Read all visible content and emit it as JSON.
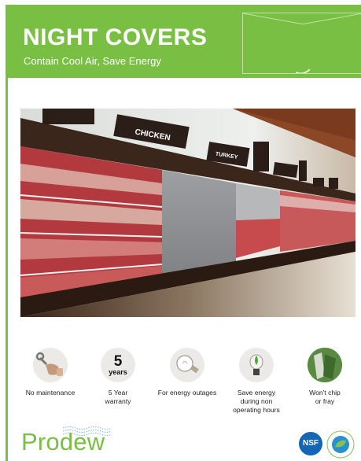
{
  "header": {
    "title": "NIGHT COVERS",
    "subtitle": "Contain Cool Air, Save Energy"
  },
  "photo": {
    "signs": [
      "CHICKEN",
      "TURKEY"
    ]
  },
  "features": [
    {
      "icon": "wrench-hand-icon",
      "label": "No maintenance"
    },
    {
      "icon": "five-years-icon",
      "number": "5",
      "unit": "years",
      "label": "5 Year warranty"
    },
    {
      "icon": "lightbulb-icon",
      "label": "For energy outages"
    },
    {
      "icon": "bulb-leaf-icon",
      "label": "Save energy during non operating hours"
    },
    {
      "icon": "fabric-swatch-icon",
      "label": "Won't chip or fray"
    }
  ],
  "footer": {
    "brand": "Prodew",
    "cert_badge": "NSF"
  },
  "colors": {
    "brand_green": "#79bf43",
    "nsf_blue": "#1565b5"
  }
}
